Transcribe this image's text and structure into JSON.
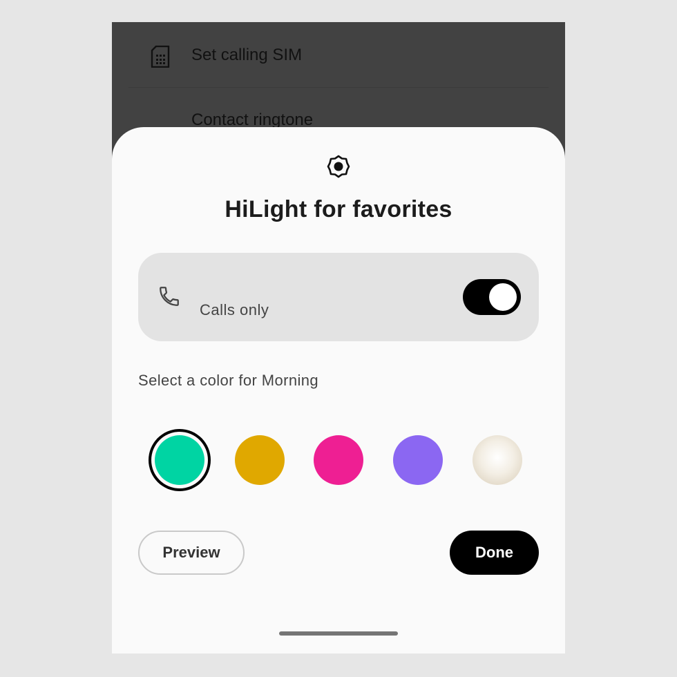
{
  "background_list": {
    "items": [
      {
        "label": "Set calling SIM",
        "icon": "sim-card-icon"
      },
      {
        "label": "Contact ringtone"
      }
    ]
  },
  "sheet": {
    "header_icon": "hilight-icon",
    "title": "HiLight for favorites",
    "calls_option": {
      "icon": "phone-icon",
      "label": "Calls only",
      "toggle_on": true
    },
    "color_prompt": "Select a color for Morning",
    "colors": [
      {
        "name": "green",
        "hex": "#00d4a3",
        "selected": true
      },
      {
        "name": "amber",
        "hex": "#e0a800",
        "selected": false
      },
      {
        "name": "magenta",
        "hex": "#ee1f93",
        "selected": false
      },
      {
        "name": "violet",
        "hex": "#8b67f2",
        "selected": false
      },
      {
        "name": "pearl",
        "hex": "#eee6d6",
        "selected": false
      }
    ],
    "preview_label": "Preview",
    "done_label": "Done"
  },
  "theme": {
    "scrim": "#424242",
    "sheet_bg": "#fafafa",
    "card_bg": "#e3e3e3",
    "accent": "#000000"
  }
}
